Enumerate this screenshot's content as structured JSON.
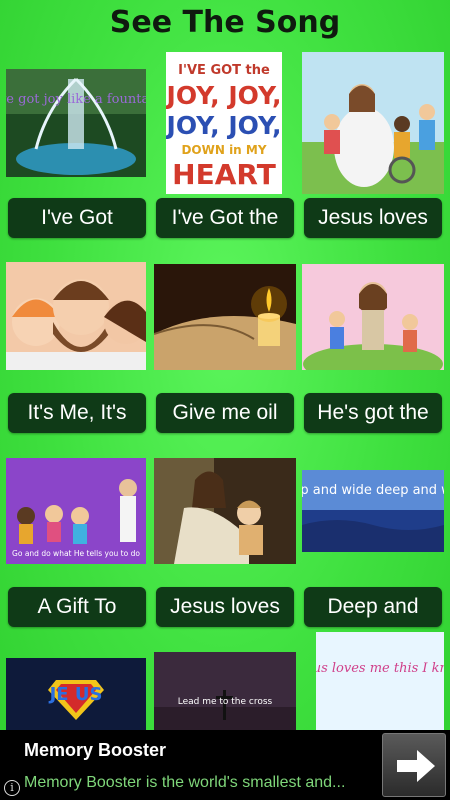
{
  "app_title": "See The Song",
  "songs": [
    {
      "label": "I've Got",
      "thumb_text": "I've got joy like a fountain",
      "icon": "fountain-thumbnail"
    },
    {
      "label": "I've Got the",
      "thumb_text": "I'VE GOT the JOY, JOY, JOY, JOY DOWN in MY HEART",
      "icon": "joy-poster-thumbnail"
    },
    {
      "label": "Jesus loves",
      "thumb_text": "",
      "icon": "jesus-with-children-thumbnail"
    },
    {
      "label": "It's Me, It's",
      "thumb_text": "",
      "icon": "cartoon-faces-thumbnail"
    },
    {
      "label": "Give me oil",
      "thumb_text": "",
      "icon": "candle-bible-thumbnail"
    },
    {
      "label": "He's got the",
      "thumb_text": "",
      "icon": "cartoon-jesus-thumbnail"
    },
    {
      "label": "A Gift To",
      "thumb_text": "Go and do what He tells you to do",
      "icon": "kids-purple-thumbnail"
    },
    {
      "label": "Jesus loves",
      "thumb_text": "",
      "icon": "jesus-holding-child-thumbnail"
    },
    {
      "label": "Deep and",
      "thumb_text": "Deep and wide deep and wide",
      "icon": "deep-and-wide-thumbnail"
    },
    {
      "label": "",
      "thumb_text": "JE US",
      "icon": "superman-jesus-thumbnail"
    },
    {
      "label": "",
      "thumb_text": "Lead me to the cross",
      "icon": "lead-me-cross-thumbnail"
    },
    {
      "label": "",
      "thumb_text": "Jesus loves me this I know",
      "icon": "jesus-loves-me-thumbnail"
    }
  ],
  "ad": {
    "title": "Memory Booster",
    "description": "Memory Booster is the world's smallest and...",
    "info_glyph": "i",
    "arrow_icon": "right-arrow-icon"
  },
  "colors": {
    "background": "#3fe03f",
    "button": "#0f3a17",
    "ad_background": "#000000",
    "ad_description": "#7fd67a"
  }
}
